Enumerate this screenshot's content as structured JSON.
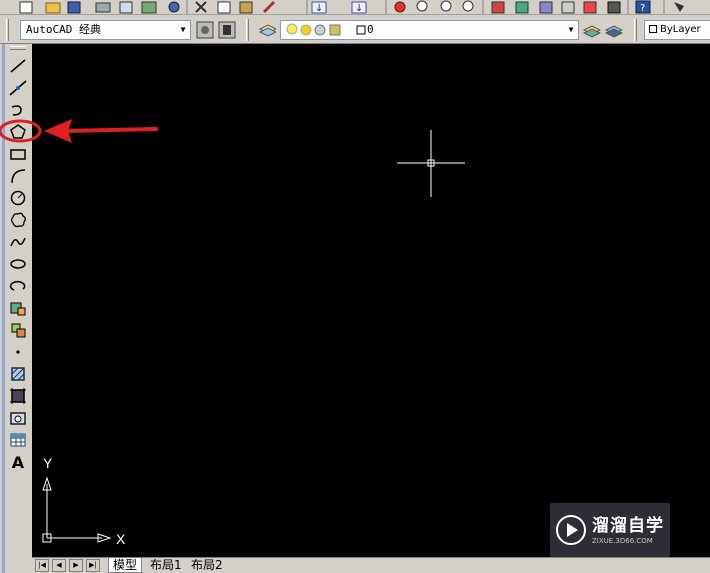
{
  "toolbar_row2": {
    "workspace_combo": "AutoCAD 经典",
    "layer_combo_value": "0",
    "linetype_combo": "ByLayer"
  },
  "draw_toolbar": {
    "text_tool_label": "A",
    "highlighted_tool": "polygon"
  },
  "ucs": {
    "x_label": "X",
    "y_label": "Y"
  },
  "layout_tabs": [
    "模型",
    "布局1",
    "布局2"
  ],
  "active_tab": "模型",
  "watermark": {
    "title": "溜溜自学",
    "subtitle": "ZIXUE.3D66.COM"
  },
  "colors": {
    "canvas": "#000000",
    "annotation": "#e02020",
    "toolbar": "#d4d0c8",
    "strip": "#8fa8d8"
  }
}
